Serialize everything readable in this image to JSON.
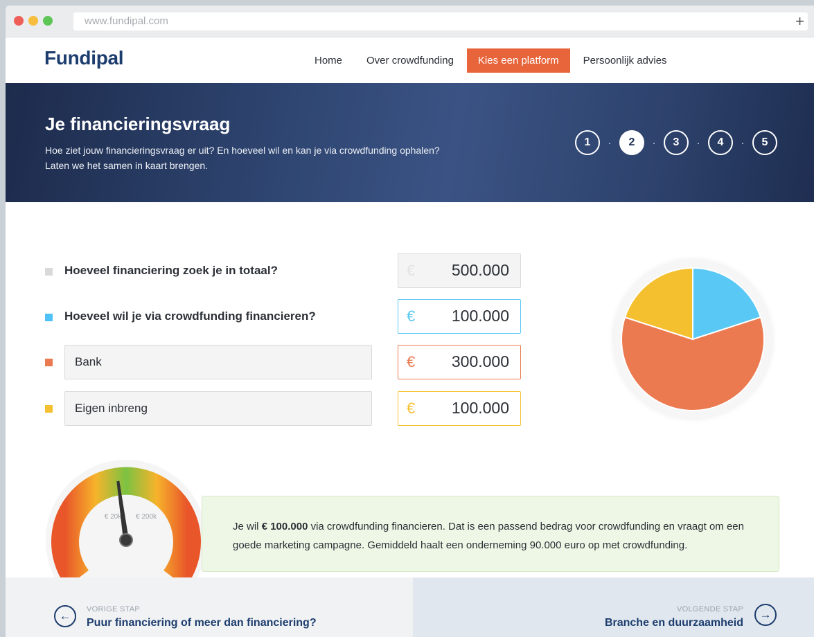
{
  "browser": {
    "url": "www.fundipal.com",
    "new_tab": "+"
  },
  "nav": {
    "logo": "Fundipal",
    "items": [
      {
        "label": "Home",
        "active": false
      },
      {
        "label": "Over crowdfunding",
        "active": false
      },
      {
        "label": "Kies een platform",
        "active": true
      },
      {
        "label": "Persoonlijk advies",
        "active": false
      }
    ]
  },
  "hero": {
    "title": "Je financieringsvraag",
    "line1": "Hoe ziet jouw financieringsvraag er uit? En hoeveel wil en kan je via crowdfunding ophalen?",
    "line2": "Laten we het samen in kaart brengen.",
    "steps": [
      "1",
      "2",
      "3",
      "4",
      "5"
    ],
    "current_step": 2,
    "separator": "·"
  },
  "form": {
    "currency": "€",
    "total": {
      "label": "Hoeveel financiering zoek je in totaal?",
      "value": "500.000",
      "color": "#d9d9d9"
    },
    "crowdfunding": {
      "label": "Hoeveel wil je via crowdfunding financieren?",
      "value": "100.000",
      "color": "#4fc3f7"
    },
    "bank": {
      "label": "Bank",
      "value": "300.000",
      "color": "#ec7a50"
    },
    "own": {
      "label": "Eigen inbreng",
      "value": "100.000",
      "color": "#f5c02f"
    }
  },
  "pie": {
    "slices": [
      {
        "name": "crowdfunding",
        "value": 100000,
        "color": "#5ac8f5"
      },
      {
        "name": "bank",
        "value": 300000,
        "color": "#ec7a50"
      },
      {
        "name": "eigen inbreng",
        "value": 100000,
        "color": "#f5c02f"
      }
    ]
  },
  "gauge": {
    "label_low": "€ 20k",
    "label_high": "€ 200k",
    "needle_fraction": 0.47
  },
  "info": {
    "pre": "Je wil ",
    "amount": "€ 100.000",
    "post": " via crowdfunding financieren. Dat is een passend bedrag voor crowdfunding en vraagt om een goede marketing campagne. Gemiddeld haalt een onderneming 90.000 euro op met crowdfunding."
  },
  "footer": {
    "prev": {
      "caption": "VORIGE STAP",
      "title": "Puur financiering of meer dan financiering?"
    },
    "next": {
      "caption": "VOLGENDE STAP",
      "title": "Branche en duurzaamheid"
    }
  }
}
